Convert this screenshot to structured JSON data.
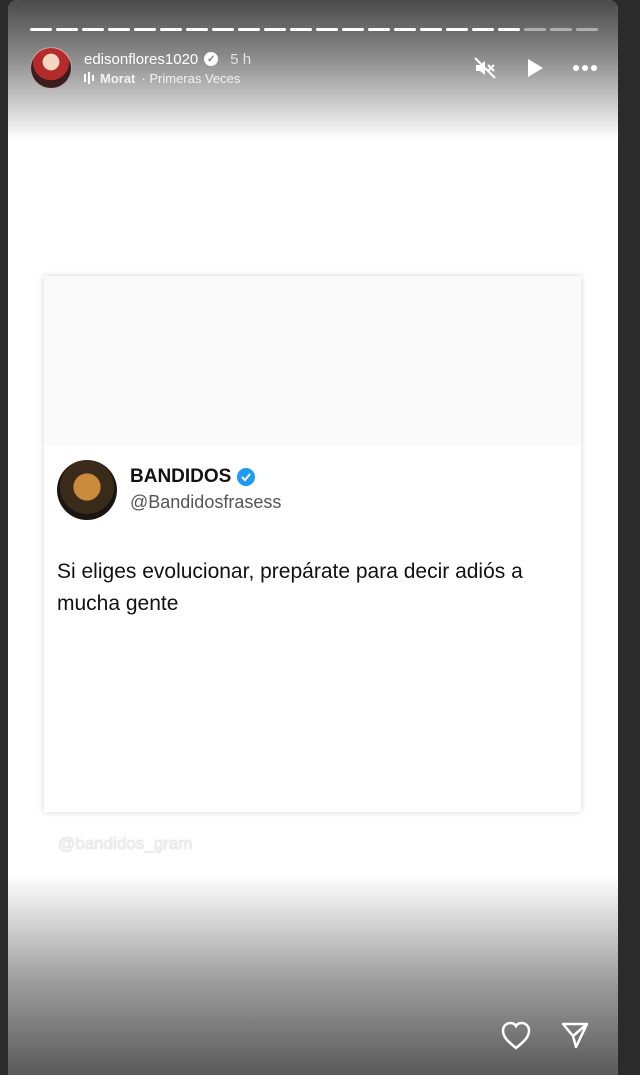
{
  "story": {
    "progress_segments": 22,
    "progress_done": 19
  },
  "header": {
    "username": "edisonflores1020",
    "time_ago": "5 h",
    "music_artist": "Morat",
    "music_song": "· Primeras Veces",
    "icons": {
      "mute": "speaker-muted-icon",
      "play": "play-icon",
      "more": "more-dots-icon"
    }
  },
  "tweet": {
    "name": "BANDIDOS",
    "handle": "@Bandidosfrasess",
    "text": "Si eliges evolucionar, prepárate para decir adiós a mucha gente"
  },
  "watermark": "@bandidos_gram",
  "footer": {
    "icons": {
      "like": "heart-icon",
      "share": "send-icon"
    }
  },
  "colors": {
    "verified_blue": "#1d9bf0"
  }
}
